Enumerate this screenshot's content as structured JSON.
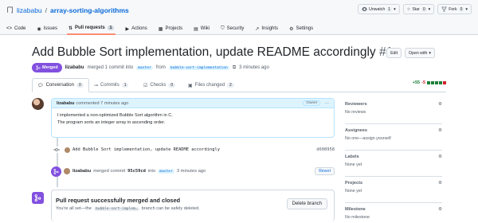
{
  "repo": {
    "owner": "lizababu",
    "separator": "/",
    "name": "array-sorting-algorithms"
  },
  "repo_actions": [
    {
      "icon": "eye-icon",
      "label": "Unwatch",
      "count": "1"
    },
    {
      "icon": "star-icon",
      "label": "Star",
      "count": "0"
    },
    {
      "icon": "fork-icon",
      "label": "Fork",
      "count": "0"
    }
  ],
  "tabs": [
    {
      "icon": "code-icon",
      "label": "Code",
      "badge": ""
    },
    {
      "icon": "issues-icon",
      "label": "Issues",
      "badge": ""
    },
    {
      "icon": "pull-request-icon",
      "label": "Pull requests",
      "badge": "1"
    },
    {
      "icon": "play-icon",
      "label": "Actions",
      "badge": ""
    },
    {
      "icon": "projects-icon",
      "label": "Projects",
      "badge": ""
    },
    {
      "icon": "wiki-icon",
      "label": "Wiki",
      "badge": ""
    },
    {
      "icon": "shield-icon",
      "label": "Security",
      "badge": ""
    },
    {
      "icon": "graph-icon",
      "label": "Insights",
      "badge": ""
    },
    {
      "icon": "gear-icon",
      "label": "Settings",
      "badge": ""
    }
  ],
  "pr": {
    "title": "Add Bubble Sort implementation, update README accordingly",
    "number": "#1",
    "edit_label": "Edit",
    "open_with_label": "Open with",
    "status_label": "Merged",
    "author": "lizababu",
    "merged_text": "merged 1 commit into",
    "base_branch": "master",
    "from_text": "from",
    "head_branch": "bubble-sort-implementation",
    "time": "3 minutes ago"
  },
  "pr_tabs": [
    {
      "label": "Conversation",
      "count": "0"
    },
    {
      "label": "Commits",
      "count": "1"
    },
    {
      "label": "Checks",
      "count": "0"
    },
    {
      "label": "Files changed",
      "count": "2"
    }
  ],
  "diff_stat": {
    "additions": "+55",
    "deletions": "-5"
  },
  "comment": {
    "author": "lizababu",
    "meta": "commented 7 minutes ago",
    "owner_badge": "Owner",
    "line1": "I implemented a non-optimized Bubble Sort algorithm in C.",
    "line2": "The program sorts an integer array in ascending order."
  },
  "commit": {
    "message": "Add Bubble Sort implementation, update README accordingly",
    "sha": "d608958"
  },
  "merge_event": {
    "author": "lizababu",
    "text": "merged commit",
    "sha": "95c59cd",
    "into": "into",
    "branch": "master",
    "time": "3 minutes ago",
    "revert_label": "Revert"
  },
  "merge_box": {
    "title": "Pull request successfully merged and closed",
    "sub_prefix": "You're all set—the",
    "branch": "bubble-sort-implem…",
    "sub_suffix": "branch can be safely deleted.",
    "button": "Delete branch"
  },
  "sidebar": [
    {
      "heading": "Reviewers",
      "value": "No reviews"
    },
    {
      "heading": "Assignees",
      "value": "No one—assign yourself"
    },
    {
      "heading": "Labels",
      "value": "None yet"
    },
    {
      "heading": "Projects",
      "value": "None yet"
    },
    {
      "heading": "Milestone",
      "value": "No milestone"
    }
  ],
  "colors": {
    "accent": "#0969da",
    "merged": "#8250df",
    "active_tab": "#fd8c73",
    "add": "#1a7f37",
    "del": "#cf222e"
  }
}
